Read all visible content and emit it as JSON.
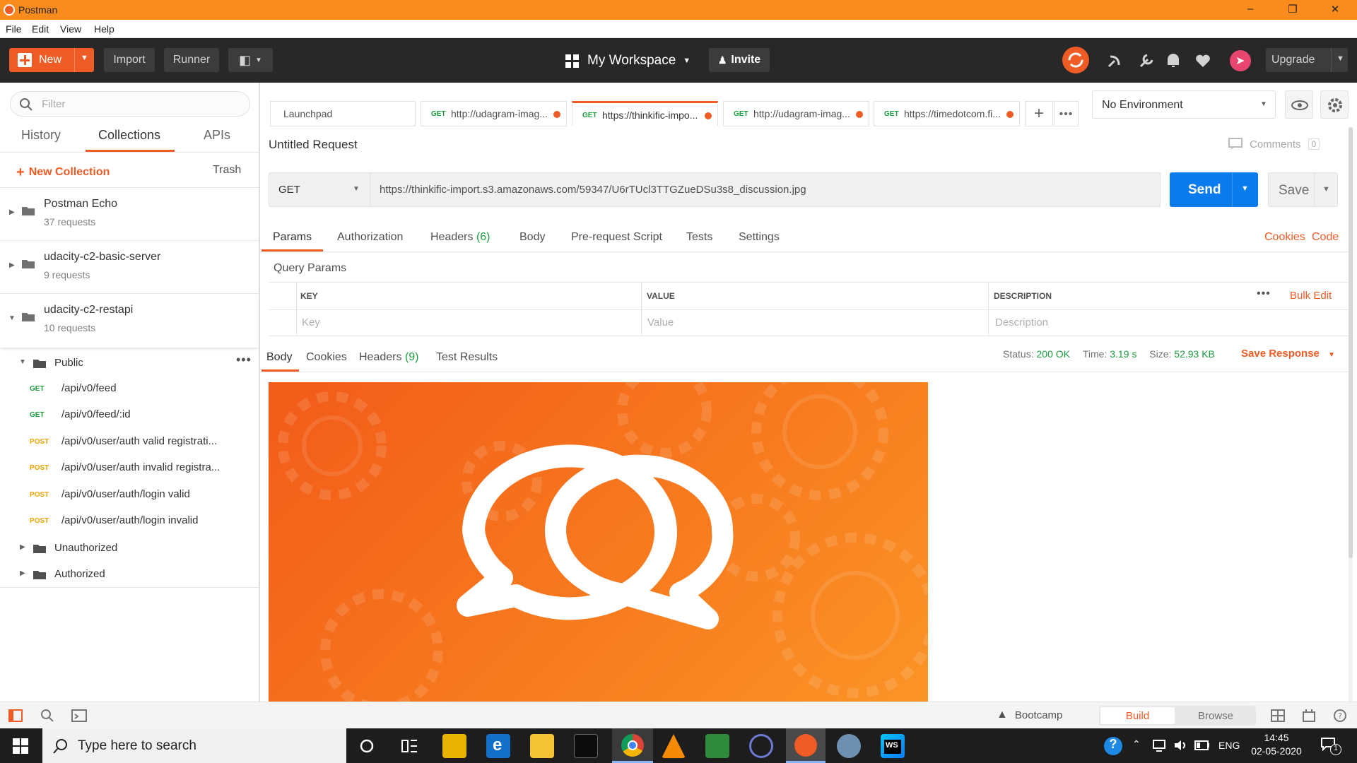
{
  "window": {
    "title": "Postman",
    "menu": [
      "File",
      "Edit",
      "View",
      "Help"
    ]
  },
  "header": {
    "new_label": "New",
    "import_label": "Import",
    "runner_label": "Runner",
    "workspace_label": "My Workspace",
    "invite_label": "Invite",
    "upgrade_label": "Upgrade"
  },
  "sidebar": {
    "filter_placeholder": "Filter",
    "tabs": [
      "History",
      "Collections",
      "APIs"
    ],
    "active_tab": "Collections",
    "new_collection_label": "New Collection",
    "trash_label": "Trash",
    "collections": [
      {
        "name": "Postman Echo",
        "count": "37 requests",
        "expanded": false
      },
      {
        "name": "udacity-c2-basic-server",
        "count": "9 requests",
        "expanded": false
      },
      {
        "name": "udacity-c2-restapi",
        "count": "10 requests",
        "expanded": true
      }
    ],
    "folders": [
      {
        "name": "Public",
        "expanded": true
      },
      {
        "name": "Unauthorized",
        "expanded": false
      },
      {
        "name": "Authorized",
        "expanded": false
      }
    ],
    "requests": [
      {
        "method": "GET",
        "path": "/api/v0/feed"
      },
      {
        "method": "GET",
        "path": "/api/v0/feed/:id"
      },
      {
        "method": "POST",
        "path": "/api/v0/user/auth valid registrati..."
      },
      {
        "method": "POST",
        "path": "/api/v0/user/auth invalid registra..."
      },
      {
        "method": "POST",
        "path": "/api/v0/user/auth/login valid"
      },
      {
        "method": "POST",
        "path": "/api/v0/user/auth/login invalid"
      }
    ]
  },
  "tabs": [
    {
      "label": "Launchpad",
      "method": ""
    },
    {
      "label": "http://udagram-imag...",
      "method": "GET"
    },
    {
      "label": "https://thinkific-impo...",
      "method": "GET",
      "active": true
    },
    {
      "label": "http://udagram-imag...",
      "method": "GET"
    },
    {
      "label": "https://timedotcom.fi...",
      "method": "GET"
    }
  ],
  "environment": {
    "selected": "No Environment"
  },
  "request": {
    "name": "Untitled Request",
    "comments_label": "Comments",
    "comments_count": "0",
    "method": "GET",
    "url": "https://thinkific-import.s3.amazonaws.com/59347/U6rTUcl3TTGZueDSu3s8_discussion.jpg",
    "send_label": "Send",
    "save_label": "Save",
    "subtabs": [
      "Params",
      "Authorization",
      "Headers",
      "Body",
      "Pre-request Script",
      "Tests",
      "Settings"
    ],
    "headers_count": "(6)",
    "cookies_label": "Cookies",
    "code_label": "Code",
    "query_params_label": "Query Params",
    "table_headers": [
      "KEY",
      "VALUE",
      "DESCRIPTION"
    ],
    "bulk_edit_label": "Bulk Edit",
    "placeholders": {
      "key": "Key",
      "value": "Value",
      "description": "Description"
    }
  },
  "response": {
    "tabs": [
      "Body",
      "Cookies",
      "Headers",
      "Test Results"
    ],
    "headers_count": "(9)",
    "status_label": "Status:",
    "status_value": "200 OK",
    "time_label": "Time:",
    "time_value": "3.19 s",
    "size_label": "Size:",
    "size_value": "52.93 KB",
    "save_response_label": "Save Response"
  },
  "statusbar": {
    "bootcamp_label": "Bootcamp",
    "build_label": "Build",
    "browse_label": "Browse"
  },
  "taskbar": {
    "search_placeholder": "Type here to search",
    "language": "ENG",
    "time": "14:45",
    "date": "02-05-2020",
    "notification_count": "1"
  },
  "colors": {
    "accent": "#ef5b25",
    "send_blue": "#097bed",
    "titlebar": "#fa8c1e",
    "header_bg": "#282828"
  }
}
